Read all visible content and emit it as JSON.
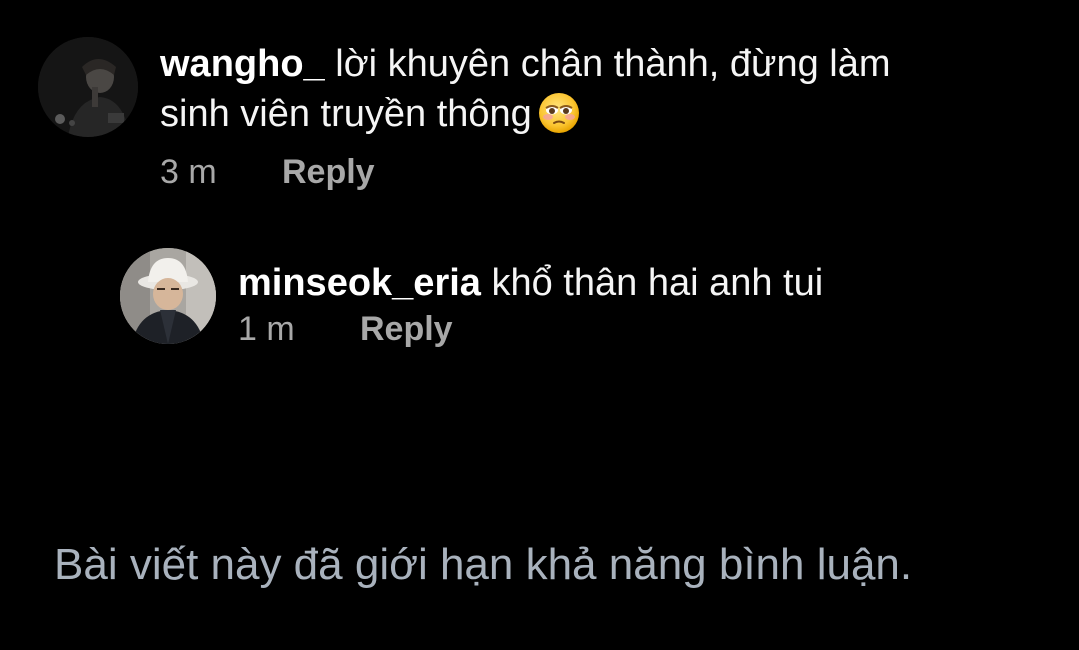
{
  "comments": [
    {
      "username": "wangho_",
      "text": "lời khuyên chân thành, đừng làm sinh viên truyền thông",
      "emoji": "pleading-face-emoji",
      "time": "3 m",
      "reply_label": "Reply"
    },
    {
      "username": "minseok_eria",
      "text": "khổ thân hai anh tui",
      "time": "1 m",
      "reply_label": "Reply"
    }
  ],
  "restricted_notice": "Bài viết này đã giới hạn khả năng bình luận.",
  "colors": {
    "background": "#000000",
    "text": "#f5f5f5",
    "meta": "#a8a8a8",
    "notice": "#a9b2bd"
  }
}
